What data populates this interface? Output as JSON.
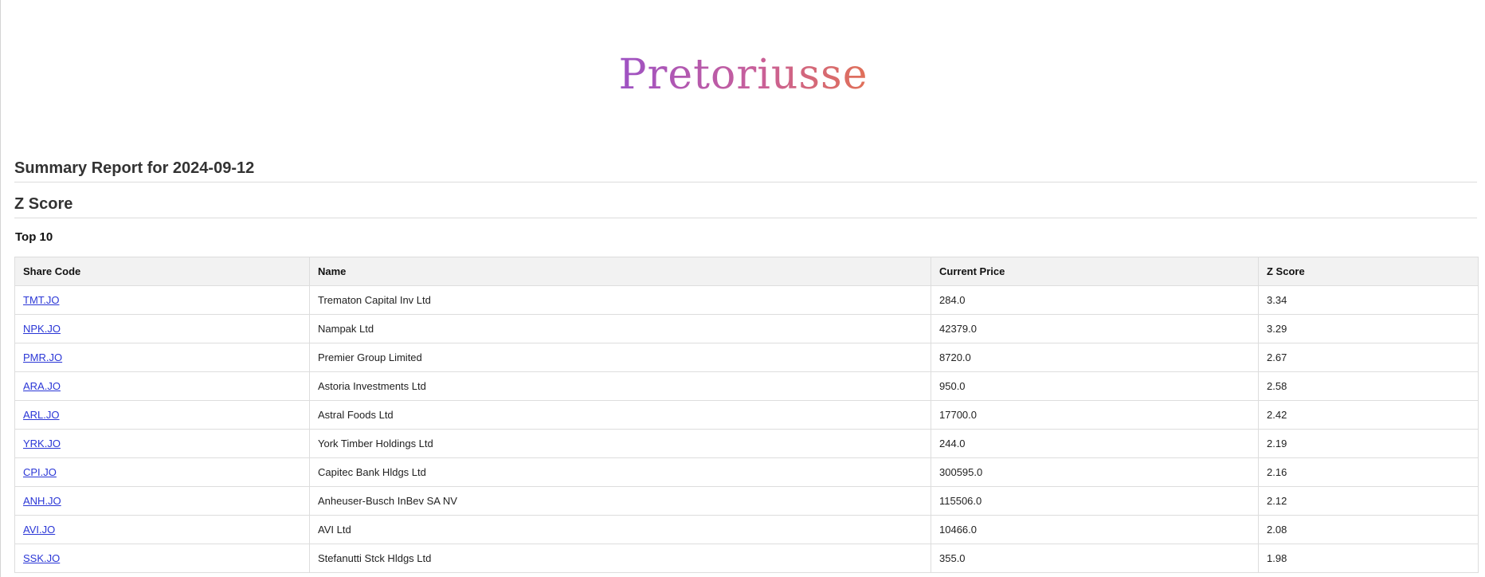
{
  "brand": {
    "logo_text": "Pretoriusse"
  },
  "report": {
    "title": "Summary Report for 2024-09-12",
    "section_title": "Z Score",
    "subsection_title": "Top 10"
  },
  "table": {
    "headers": {
      "share_code": "Share Code",
      "name": "Name",
      "current_price": "Current Price",
      "z_score": "Z Score"
    },
    "rows": [
      {
        "share_code": "TMT.JO",
        "name": "Trematon Capital Inv Ltd",
        "current_price": "284.0",
        "z_score": "3.34"
      },
      {
        "share_code": "NPK.JO",
        "name": "Nampak Ltd",
        "current_price": "42379.0",
        "z_score": "3.29"
      },
      {
        "share_code": "PMR.JO",
        "name": "Premier Group Limited",
        "current_price": "8720.0",
        "z_score": "2.67"
      },
      {
        "share_code": "ARA.JO",
        "name": "Astoria Investments Ltd",
        "current_price": "950.0",
        "z_score": "2.58"
      },
      {
        "share_code": "ARL.JO",
        "name": "Astral Foods Ltd",
        "current_price": "17700.0",
        "z_score": "2.42"
      },
      {
        "share_code": "YRK.JO",
        "name": "York Timber Holdings Ltd",
        "current_price": "244.0",
        "z_score": "2.19"
      },
      {
        "share_code": "CPI.JO",
        "name": "Capitec Bank Hldgs Ltd",
        "current_price": "300595.0",
        "z_score": "2.16"
      },
      {
        "share_code": "ANH.JO",
        "name": "Anheuser-Busch InBev SA NV",
        "current_price": "115506.0",
        "z_score": "2.12"
      },
      {
        "share_code": "AVI.JO",
        "name": "AVI Ltd",
        "current_price": "10466.0",
        "z_score": "2.08"
      },
      {
        "share_code": "SSK.JO",
        "name": "Stefanutti Stck Hldgs Ltd",
        "current_price": "355.0",
        "z_score": "1.98"
      }
    ]
  },
  "colors": {
    "logo_gradient_start": "#9e52c4",
    "logo_gradient_end": "#e07058",
    "link": "#2a36d6",
    "header_bg": "#f2f2f2",
    "border": "#dddddd"
  }
}
